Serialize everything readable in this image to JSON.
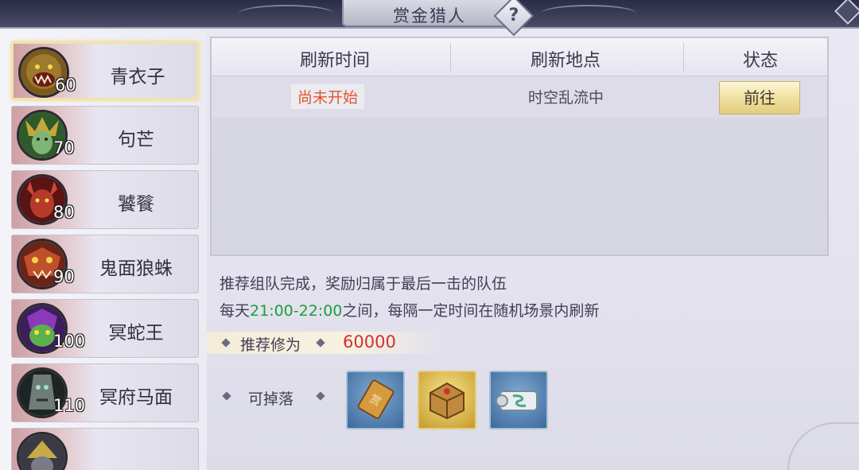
{
  "title": "赏金猎人",
  "help_icon": "?",
  "bosses": [
    {
      "name": "青衣子",
      "level": "60",
      "icon": "green-ogre-portrait",
      "selected": true
    },
    {
      "name": "句芒",
      "level": "70",
      "icon": "green-lady-portrait"
    },
    {
      "name": "饕餮",
      "level": "80",
      "icon": "red-demon-portrait"
    },
    {
      "name": "鬼面狼蛛",
      "level": "90",
      "icon": "spider-mask-portrait"
    },
    {
      "name": "冥蛇王",
      "level": "100",
      "icon": "serpent-king-portrait"
    },
    {
      "name": "冥府马面",
      "level": "110",
      "icon": "horse-face-portrait"
    },
    {
      "name": "",
      "level": "",
      "icon": "armored-portrait"
    }
  ],
  "table": {
    "headers": [
      "刷新时间",
      "刷新地点",
      "状态"
    ],
    "rows": [
      {
        "time": "尚未开始",
        "location": "时空乱流中",
        "action": "前往"
      }
    ]
  },
  "info": {
    "line1": "推荐组队完成，奖励归属于最后一击的队伍",
    "line2_prefix": "每天",
    "line2_time": "21:00-22:00",
    "line2_suffix": "之间，每隔一定时间在随机场景内刷新"
  },
  "recommend": {
    "label": "推荐修为",
    "value": "60000"
  },
  "drops": {
    "label": "可掉落",
    "items": [
      {
        "icon": "bounty-token-icon",
        "color": "#4f80b5"
      },
      {
        "icon": "treasure-chest-icon",
        "color": "#d9b24a"
      },
      {
        "icon": "scroll-icon",
        "color": "#4f80b5"
      }
    ]
  },
  "colors": {
    "accent_red": "#d2322b",
    "accent_green": "#1f9d3c",
    "status_orange": "#e0562b"
  }
}
